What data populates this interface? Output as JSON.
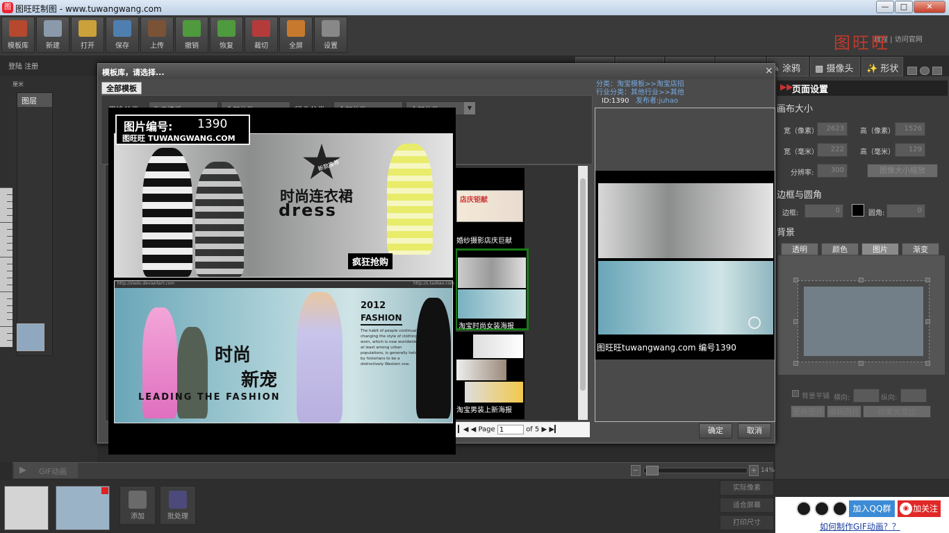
{
  "window": {
    "title": "图旺旺制图 - www.tuwangwang.com",
    "icon_text": "图"
  },
  "toolbar": {
    "items": [
      {
        "label": "模板库",
        "color": "#b5482d"
      },
      {
        "label": "新建",
        "color": "#8a9aab"
      },
      {
        "label": "打开",
        "color": "#caa13a"
      },
      {
        "label": "保存",
        "color": "#4f7fb0"
      },
      {
        "label": "上传",
        "color": "#7a5236"
      },
      {
        "label": "撤销",
        "color": "#4f9a3e"
      },
      {
        "label": "恢复",
        "color": "#4f9a3e"
      },
      {
        "label": "裁切",
        "color": "#b53b3b"
      },
      {
        "label": "全屏",
        "color": "#c77a2e"
      },
      {
        "label": "设置",
        "color": "#888888"
      }
    ]
  },
  "brand": {
    "name": "图旺旺",
    "links": "教程 | 访问官网"
  },
  "account": {
    "text": "登陆  注册"
  },
  "top_tabs": {
    "paint": "涂鸦",
    "camera": "摄像头",
    "shape": "形状"
  },
  "right_panel": {
    "title": "页面设置",
    "canvas_size": "画布大小",
    "width_px_label": "宽（像素）",
    "width_px": "2623",
    "height_px_label": "高（像素）",
    "height_px": "1526",
    "width_mm_label": "宽（毫米）",
    "width_mm": "222",
    "height_mm_label": "高（毫米）",
    "height_mm": "129",
    "dpi_label": "分辨率:",
    "dpi": "300",
    "resize_btn": "图像大小缩放",
    "border_section": "边框与圆角",
    "border_label": "边框:",
    "border_value": "0",
    "radius_label": "圆角:",
    "radius_value": "0",
    "background_section": "背景",
    "bg_tabs": [
      "透明",
      "颜色",
      "图片",
      "渐变"
    ],
    "tile_label": "背景平铺",
    "h_label": "横向:",
    "v_label": "纵向:",
    "change_image": "更换图片",
    "edit_image": "编辑图片",
    "keep_ratio": "约束长宽比"
  },
  "left_panel": {
    "layers_title": "图层",
    "ruler_label": "厘米"
  },
  "gif": {
    "label": "GIF动画",
    "zoom": "14%"
  },
  "bottom": {
    "add": "添加",
    "batch": "批处理",
    "actual": "实际像素",
    "fit": "适合屏幕",
    "print": "打印尺寸"
  },
  "social": {
    "join": "加入QQ群",
    "follow": "加关注",
    "howto": "如何制作GIF动画？？"
  },
  "dialog": {
    "title": "模板库，请选择...",
    "tab": "全部模板",
    "filter_use_label": "用途分类",
    "filter_use": "淘宝模板",
    "filter_all1": "全部分类",
    "filter_industry_label": "行业分类",
    "filter_all2": "全部分类",
    "filter_all3": "全部分类",
    "info_category": "分类：淘宝模板>>淘宝店招",
    "info_industry": "行业分类：其他行业>>其他",
    "info_id": "ID:1390",
    "info_author": "发布者:juhao",
    "list_items": [
      {
        "caption": "婚纱摄影店庆巨献",
        "tag": "店庆钜献"
      },
      {
        "caption": "淘宝时尚女装海报"
      },
      {
        "caption": "淘宝男装上新海报"
      }
    ],
    "pager": {
      "page_label": "Page",
      "page_value": "1",
      "of_label": "of 5"
    },
    "ok": "确定",
    "cancel": "取消",
    "preview_caption": "图旺旺tuwangwang.com 编号1390"
  },
  "zoom": {
    "id_label": "图片编号:",
    "id_value": "1390",
    "site": "图旺旺  TUWANGWANG.COM",
    "b1_title": "时尚连衣裙",
    "b1_word": "dress",
    "b1_badge": "新款推荐",
    "b1_cta": "疯狂抢购",
    "b2_year": "2012",
    "b2_fashion": "FASHION",
    "b2_title1": "时尚",
    "b2_title2": "新宠",
    "b2_slogan": "LEADING THE FASHION",
    "b2_copy": "The habit of people continually changing the style of clothing worn, which is now worldwide, at least among urban populations, is generally held by historians to be a distinctively Western one.",
    "b2_url_left": "http://sladu.deviantart.com",
    "b2_url_right": "http://s.taobao.com"
  }
}
